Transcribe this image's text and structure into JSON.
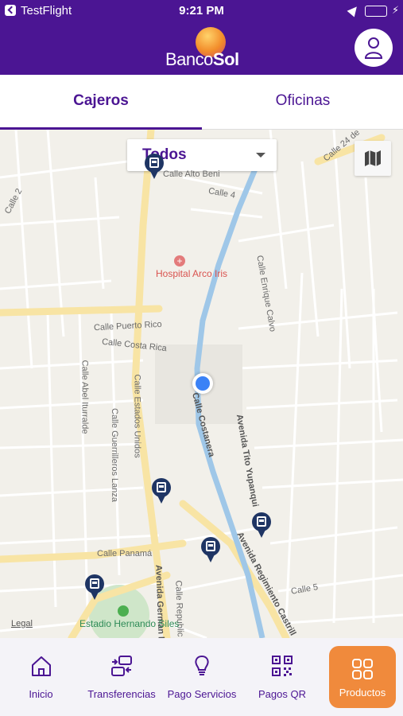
{
  "status_bar": {
    "carrier": "TestFlight",
    "time": "9:21 PM",
    "battery_level": 1.0
  },
  "header": {
    "logo_text_light": "Banco",
    "logo_text_bold": "Sol",
    "profile_icon": "user-icon"
  },
  "tabs": [
    {
      "label": "Cajeros",
      "active": true
    },
    {
      "label": "Oficinas",
      "active": false
    }
  ],
  "map": {
    "filter_value": "Todos",
    "map_type_icon": "map-icon",
    "legal_text": "Legal",
    "streets": [
      "Calle 24 de",
      "Calle Alto Beni",
      "Calle 4",
      "Calle 2",
      "Calle Enrique Calvo",
      "Calle Puerto Rico",
      "Calle Costa Rica",
      "Calle Abel Iturralde",
      "Calle Estados Unidos",
      "Calle Guerrilleros Lanza",
      "Calle Costanera",
      "Avenida Tito Yupanqui",
      "Calle Panamá",
      "Avenida German B",
      "Calle Republic",
      "Avenida Regimiento Castrill",
      "Calle 5"
    ],
    "pois": {
      "hospital": "Hospital Arco Iris",
      "stadium": "Estadio Hernando Siles"
    },
    "colors": {
      "land": "#f2f0ea",
      "major_road": "#f8e4a4",
      "river": "#9fc7e8",
      "pin": "#1f3564",
      "user_location": "#3b82f6"
    }
  },
  "bottom_nav": [
    {
      "label": "Inicio",
      "icon": "home-icon"
    },
    {
      "label": "Transferencias",
      "icon": "transfer-icon"
    },
    {
      "label": "Pago Servicios",
      "icon": "lightbulb-icon"
    },
    {
      "label": "Pagos QR",
      "icon": "qr-code-icon"
    },
    {
      "label": "Productos",
      "icon": "grid-icon"
    }
  ],
  "theme": {
    "primary": "#4b1593",
    "accent": "#f08a3c"
  }
}
